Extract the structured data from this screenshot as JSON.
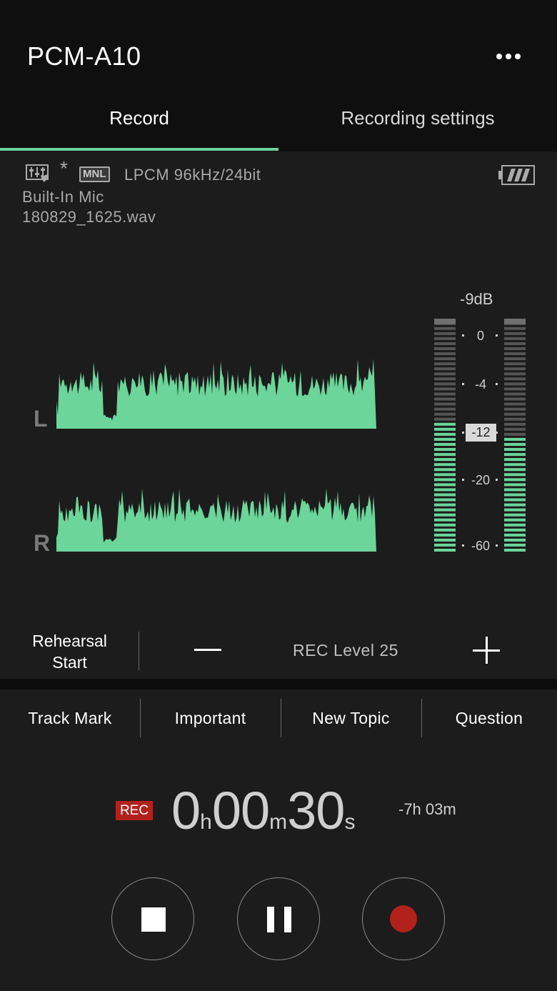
{
  "header": {
    "title": "PCM-A10",
    "tabs": [
      {
        "label": "Record",
        "active": true
      },
      {
        "label": "Recording settings",
        "active": false
      }
    ]
  },
  "info": {
    "mode_badge": "MNL",
    "format": "LPCM 96kHz/24bit",
    "input": "Built-In Mic",
    "filename": "180829_1625.wav",
    "asterisk": "*",
    "icons": [
      "sound-settings-icon",
      "battery-icon"
    ]
  },
  "waveform": {
    "left_label": "L",
    "right_label": "R",
    "color": "#6bd59a"
  },
  "meter": {
    "peak_label": "-9dB",
    "scale": [
      "0",
      "-4",
      "-12",
      "-20",
      "-60"
    ],
    "highlighted": "-12",
    "left_level": 0.58,
    "right_level": 0.52,
    "active_color": "#6bd59a",
    "inactive_color": "#555555",
    "peak_color": "#6f6f6f"
  },
  "level": {
    "rehearsal_line1": "Rehearsal",
    "rehearsal_line2": "Start",
    "rec_level_text": "REC Level 25"
  },
  "marks": [
    "Track Mark",
    "Important",
    "New Topic",
    "Question"
  ],
  "timer": {
    "rec_badge": "REC",
    "hours": "0",
    "hours_unit": "h",
    "minutes": "00",
    "minutes_unit": "m",
    "seconds": "30",
    "seconds_unit": "s",
    "remaining": "-7h 03m"
  },
  "controls": [
    "stop-button",
    "pause-button",
    "record-button"
  ],
  "colors": {
    "accent": "#6bd1a0",
    "rec_red": "#b3211c",
    "background": "#1c1c1c",
    "header": "#0f0f0f"
  }
}
